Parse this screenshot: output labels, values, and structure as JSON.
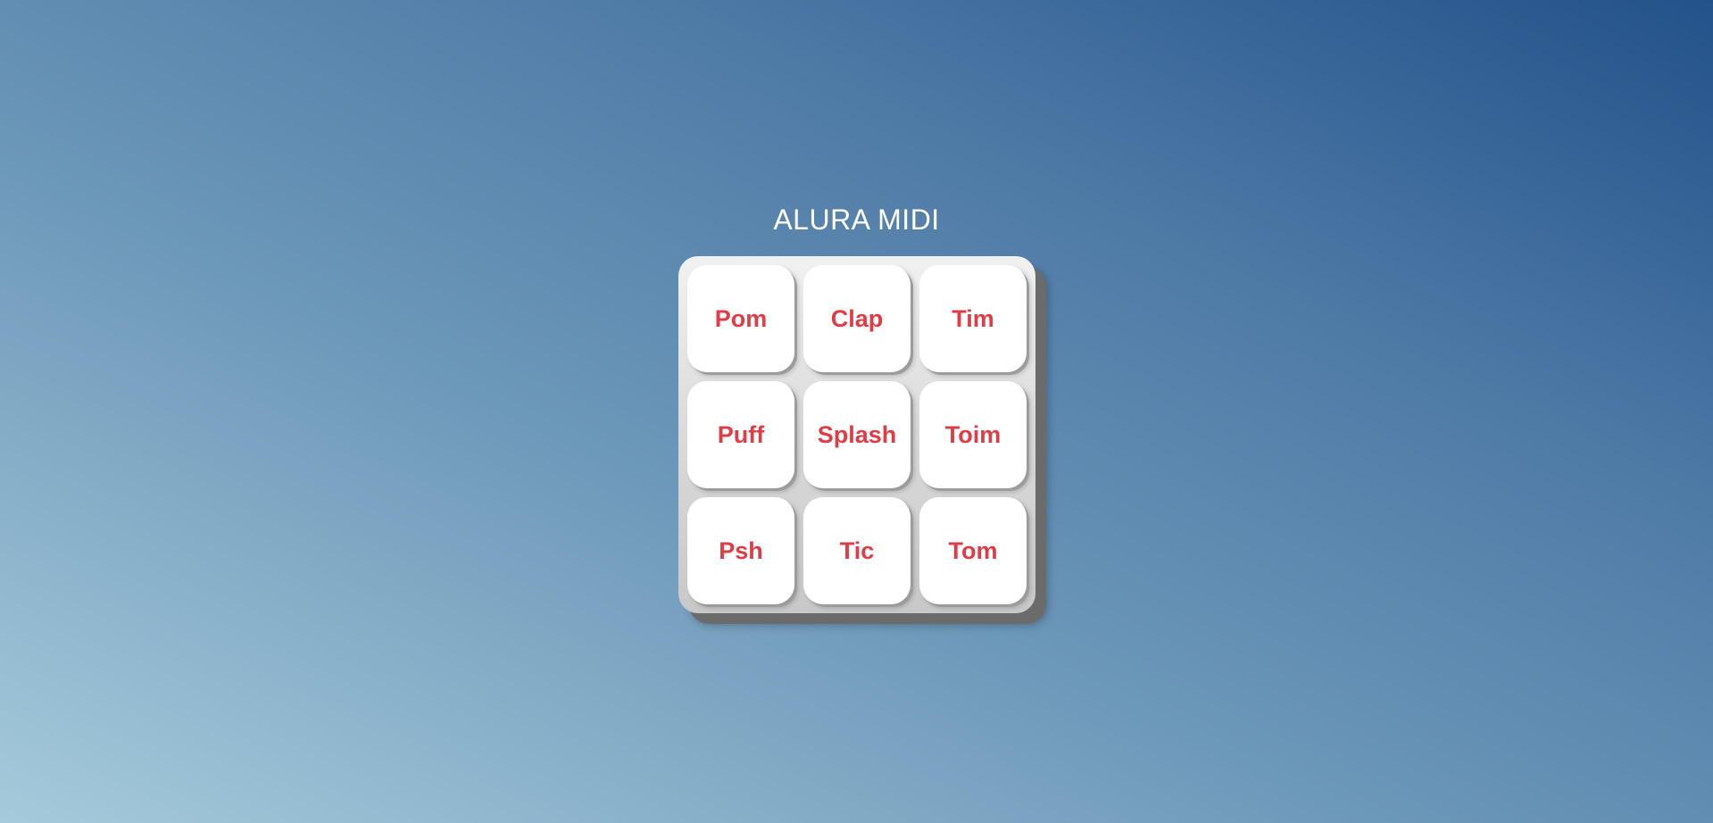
{
  "app": {
    "title": "ALURA MIDI"
  },
  "pads": [
    {
      "label": "Pom"
    },
    {
      "label": "Clap"
    },
    {
      "label": "Tim"
    },
    {
      "label": "Puff"
    },
    {
      "label": "Splash"
    },
    {
      "label": "Toim"
    },
    {
      "label": "Psh"
    },
    {
      "label": "Tic"
    },
    {
      "label": "Tom"
    }
  ],
  "colors": {
    "pad_text": "#e03c46",
    "pad_background": "#ffffff",
    "title_text": "#ffffff",
    "background_light": "#a5cadb",
    "background_dark": "#23528a"
  }
}
